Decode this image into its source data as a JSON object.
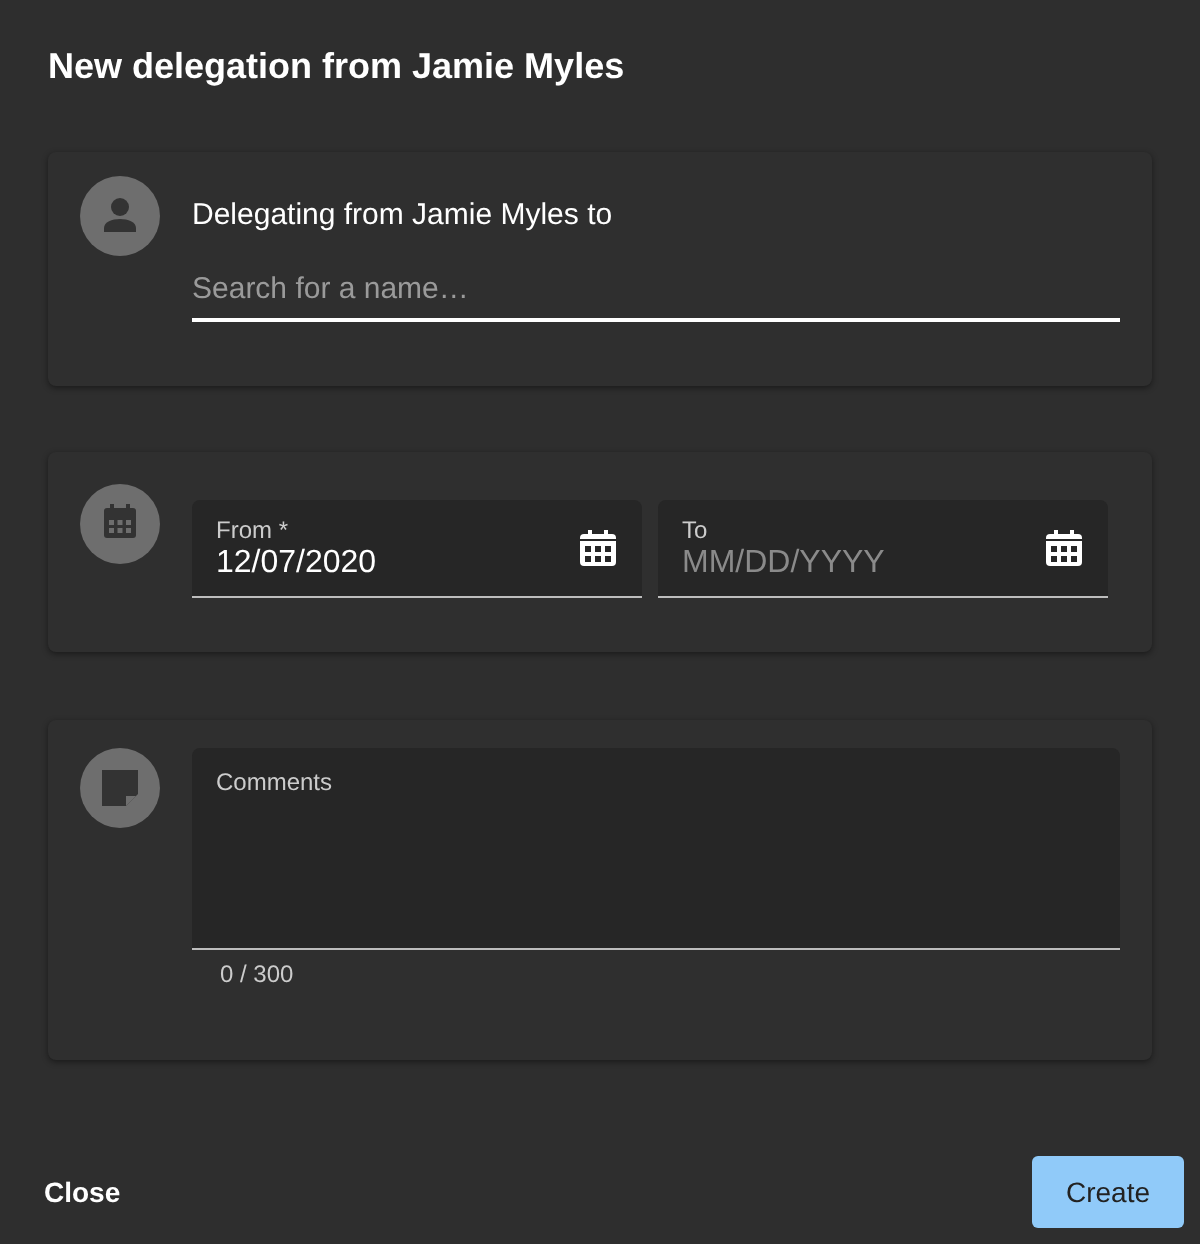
{
  "dialog": {
    "title": "New delegation from Jamie Myles"
  },
  "delegate": {
    "label": "Delegating from Jamie Myles to",
    "search": {
      "placeholder": "Search for a name…"
    }
  },
  "dates": [
    {
      "label": "From *",
      "value": "12/07/2020"
    },
    {
      "label": "To",
      "placeholder": "MM/DD/YYYY"
    }
  ],
  "comments": {
    "label": "Comments",
    "counter": "0 / 300"
  },
  "buttons": {
    "close": "Close",
    "create": "Create"
  }
}
